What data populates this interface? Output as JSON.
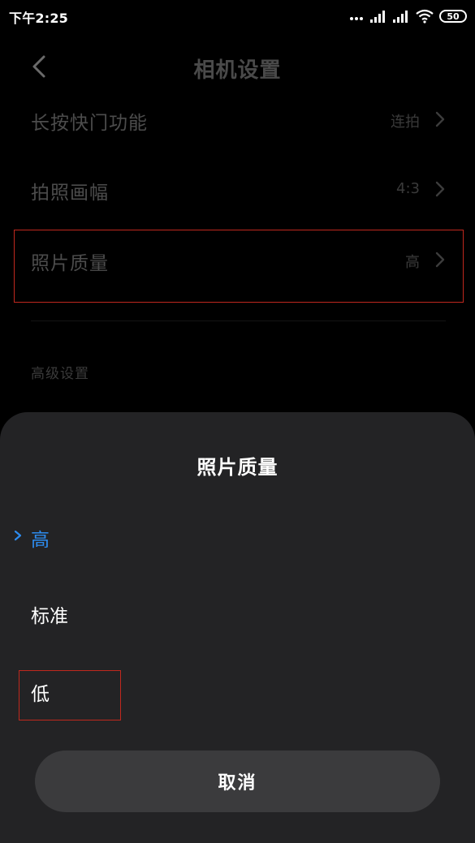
{
  "status_bar": {
    "time": "下午2:25",
    "battery": "50",
    "icons": [
      "more-dots-icon",
      "signal-icon",
      "signal-icon",
      "wifi-icon",
      "battery-icon"
    ]
  },
  "header": {
    "title": "相机设置",
    "back_icon": "back-chevron-icon"
  },
  "settings": {
    "items": [
      {
        "label": "长按快门功能",
        "value": "连拍"
      },
      {
        "label": "拍照画幅",
        "value": "4:3"
      },
      {
        "label": "照片质量",
        "value": "高"
      }
    ],
    "section_header": "高级设置"
  },
  "sheet": {
    "title": "照片质量",
    "options": [
      {
        "label": "高",
        "selected": true
      },
      {
        "label": "标准",
        "selected": false
      },
      {
        "label": "低",
        "selected": false
      }
    ],
    "cancel_label": "取消"
  },
  "colors": {
    "background": "#000000",
    "sheet": "#232325",
    "accent": "#2d8cf0",
    "highlight": "#c0281e",
    "cancel_button": "#3b3b3d"
  }
}
